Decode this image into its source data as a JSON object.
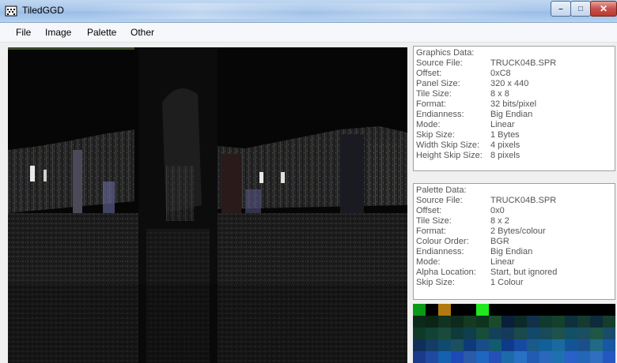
{
  "window": {
    "title": "TiledGGD",
    "buttons": {
      "minimize": "–",
      "maximize": "□",
      "close": "✕"
    }
  },
  "menu": [
    "File",
    "Image",
    "Palette",
    "Other"
  ],
  "graphics_data": {
    "title": "Graphics Data:",
    "rows": [
      {
        "label": "Source File:",
        "value": "TRUCK04B.SPR"
      },
      {
        "label": "Offset:",
        "value": "0xC8"
      },
      {
        "label": "Panel Size:",
        "value": "320 x 440"
      },
      {
        "label": "Tile Size:",
        "value": "8 x 8"
      },
      {
        "label": "Format:",
        "value": "32 bits/pixel"
      },
      {
        "label": "Endianness:",
        "value": "Big Endian"
      },
      {
        "label": "Mode:",
        "value": "Linear"
      },
      {
        "label": "Skip Size:",
        "value": "1 Bytes"
      },
      {
        "label": "Width Skip Size:",
        "value": "4 pixels"
      },
      {
        "label": "Height Skip Size:",
        "value": "8 pixels"
      }
    ]
  },
  "palette_data": {
    "title": "Palette Data:",
    "rows": [
      {
        "label": "Source File:",
        "value": "TRUCK04B.SPR"
      },
      {
        "label": "Offset:",
        "value": "0x0"
      },
      {
        "label": "Tile Size:",
        "value": "8 x 2"
      },
      {
        "label": "Format:",
        "value": "2 Bytes/colour"
      },
      {
        "label": "Colour Order:",
        "value": "BGR"
      },
      {
        "label": "Endianness:",
        "value": "Big Endian"
      },
      {
        "label": "Mode:",
        "value": "Linear"
      },
      {
        "label": "Alpha Location:",
        "value": "Start, but ignored"
      },
      {
        "label": "Skip Size:",
        "value": "1 Colour"
      }
    ]
  },
  "palette_swatches": [
    [
      "#0a9a1a",
      "#000000",
      "#b07a10",
      "#000000",
      "#000000",
      "#1ee81e",
      "#000000",
      "#000000",
      "#000000",
      "#000000",
      "#000000",
      "#000000",
      "#000000",
      "#000000",
      "#000000",
      "#000000"
    ],
    [
      "#0c2a1a",
      "#0a2416",
      "#123222",
      "#0e2a1c",
      "#143a22",
      "#0f331e",
      "#1a4a2a",
      "#0a1f3a",
      "#0b2a2a",
      "#12304a",
      "#103a2e",
      "#14402c",
      "#0e2f3e",
      "#173a30",
      "#0d2b3b",
      "#163d2c"
    ],
    [
      "#0f3a2a",
      "#124236",
      "#1a4a3a",
      "#0e3a3a",
      "#103e4c",
      "#164e3a",
      "#14405a",
      "#163a5a",
      "#1a4a4a",
      "#12486a",
      "#184a5a",
      "#1e524a",
      "#125066",
      "#1a4e60",
      "#205646",
      "#184c6a"
    ],
    [
      "#0f2f5a",
      "#143c64",
      "#104a70",
      "#1a5060",
      "#0e3a7a",
      "#1a4c8a",
      "#125c6e",
      "#0f3a8a",
      "#164aa0",
      "#1a5a8a",
      "#12609a",
      "#1a6aa0",
      "#145496",
      "#1b4f8c",
      "#206a86",
      "#1858a2"
    ],
    [
      "#1a3a8a",
      "#204aa0",
      "#1660b0",
      "#1d4ab6",
      "#2a5aa8",
      "#1e66c0",
      "#2450b8",
      "#1c6aa8",
      "#2870c4",
      "#225cb0",
      "#2a68bc",
      "#1e70b0",
      "#2a60c8",
      "#2466b6",
      "#306ec0",
      "#2458c0"
    ]
  ]
}
